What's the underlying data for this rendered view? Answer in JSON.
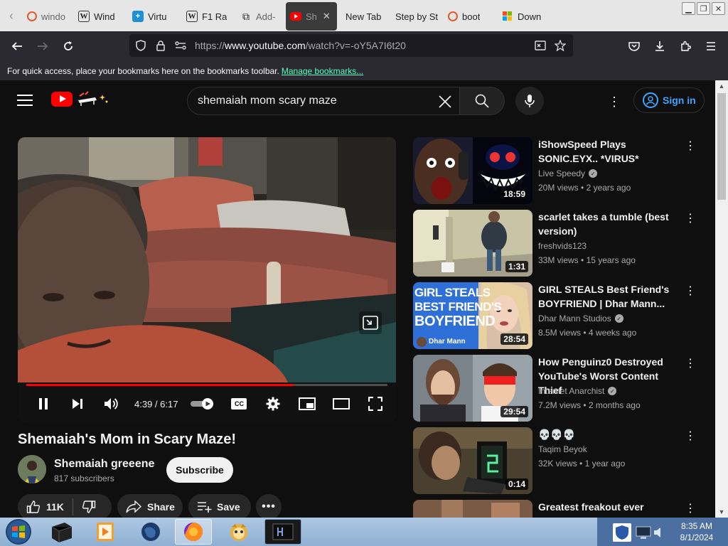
{
  "browser": {
    "tabs": [
      {
        "label": "windo",
        "icon": "opera-icon"
      },
      {
        "label": "Wind",
        "icon": "wiki-icon"
      },
      {
        "label": "Virtu",
        "icon": "plus-icon"
      },
      {
        "label": "F1 Ra",
        "icon": "wiki-icon"
      },
      {
        "label": "Add-",
        "icon": "puzzle-icon"
      },
      {
        "label": "Sh",
        "icon": "youtube-icon"
      },
      {
        "label": "New Tab",
        "icon": ""
      },
      {
        "label": "Step by St",
        "icon": ""
      },
      {
        "label": "boot",
        "icon": "opera-icon"
      },
      {
        "label": "Down",
        "icon": "windows-icon"
      }
    ],
    "url_prefix": "https://",
    "url_host": "www.youtube.com",
    "url_path": "/watch?v=-oY5A7I6t20",
    "bookmarks_text": "For quick access, place your bookmarks here on the bookmarks toolbar.",
    "bookmarks_link": "Manage bookmarks..."
  },
  "youtube": {
    "search_query": "shemaiah mom scary maze",
    "signin_label": "Sign in",
    "player": {
      "time": "4:39 / 6:17",
      "progress_played": 0.74,
      "progress_loaded": 0.74
    },
    "video_title": "Shemaiah's Mom in Scary Maze!",
    "channel_name": "Shemaiah greeene",
    "subscribers": "817 subscribers",
    "subscribe_label": "Subscribe",
    "likes": "11K",
    "share_label": "Share",
    "save_label": "Save"
  },
  "recommendations": [
    {
      "title": "iShowSpeed Plays SONIC.EYX.. *VIRUS*",
      "channel": "Live Speedy",
      "verified": true,
      "views": "20M views",
      "age": "2 years ago",
      "duration": "18:59"
    },
    {
      "title": "scarlet takes a tumble (best version)",
      "channel": "freshvids123",
      "verified": false,
      "views": "33M views",
      "age": "15 years ago",
      "duration": "1:31"
    },
    {
      "title": "GIRL STEALS Best Friend's BOYFRIEND | Dhar Mann...",
      "channel": "Dhar Mann Studios",
      "verified": true,
      "views": "8.5M views",
      "age": "4 weeks ago",
      "duration": "28:54",
      "thumb_text": [
        "GIRL STEALS",
        "BEST FRIEND'S",
        "BOYFRIEND"
      ],
      "thumb_brand": "Dhar Mann"
    },
    {
      "title": "How Penguinz0 Destroyed YouTube's Worst Content Thief",
      "channel": "Internet Anarchist",
      "verified": true,
      "views": "7.2M views",
      "age": "2 months ago",
      "duration": "29:54"
    },
    {
      "title": "💀💀💀",
      "channel": "Taqim Beyok",
      "verified": false,
      "views": "32K views",
      "age": "1 year ago",
      "duration": "0:14"
    },
    {
      "title": "Greatest freakout ever",
      "channel": "",
      "verified": false,
      "views": "",
      "age": "",
      "duration": ""
    }
  ],
  "taskbar": {
    "time": "8:35 AM",
    "date": "8/1/2024"
  }
}
